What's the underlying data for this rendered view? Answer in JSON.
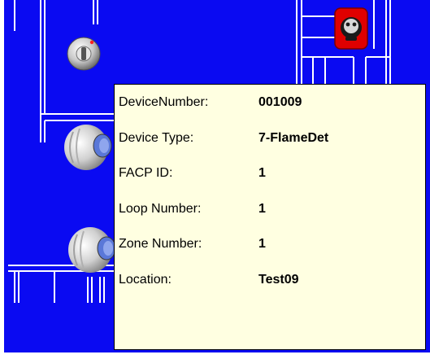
{
  "floor_plan": {
    "background_color": "#0a0af2",
    "wall_color": "#ffffff",
    "devices": [
      {
        "id": "smoke-detector-icon",
        "kind": "smoke detector"
      },
      {
        "id": "flame-detector-icon",
        "kind": "flame detector",
        "state_color": "#e00000"
      },
      {
        "id": "speaker-horn-icon-1",
        "kind": "horn speaker"
      },
      {
        "id": "speaker-horn-icon-2",
        "kind": "horn speaker"
      }
    ]
  },
  "tooltip": {
    "background_color": "#ffffe1",
    "rows": [
      {
        "label": "DeviceNumber:",
        "value": "001009"
      },
      {
        "label": "Device Type:",
        "value": "7-FlameDet"
      },
      {
        "label": "FACP ID:",
        "value": "1"
      },
      {
        "label": "Loop Number:",
        "value": "1"
      },
      {
        "label": "Zone Number:",
        "value": "1"
      },
      {
        "label": "Location:",
        "value": "Test09"
      }
    ]
  }
}
